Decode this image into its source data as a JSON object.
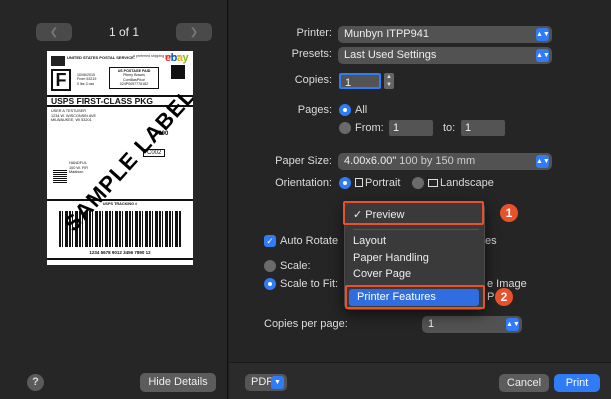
{
  "sidebar": {
    "page_indicator": "1 of 1",
    "prev_icon": "chevron-left-icon",
    "next_icon": "chevron-right-icon",
    "help_label": "?",
    "hide_details_label": "Hide Details",
    "preview": {
      "carrier_text": "UNITED STATES POSTAL SERVICE.",
      "ebay_small": "a preferred shipping service on",
      "ebay_logo": [
        "e",
        "b",
        "a",
        "y"
      ],
      "big_letter": "F",
      "date_text": [
        "10/06/2015",
        "From 53219",
        "0 lbs 3 ozs"
      ],
      "paid_text": [
        "US POSTAGE PAID",
        "Pitney Bowes",
        "ComBasPrice",
        "024P0097776182"
      ],
      "service": "USPS FIRST-CLASS PKG",
      "sender": [
        "USER A TESTUSER",
        "1234 W. WISCONSIN AVE",
        "MILWAUKEE, WI 53201"
      ],
      "number": "0000",
      "route": "C002",
      "ship_to": [
        "HANDFUL",
        "100 W. FIR",
        "Madison"
      ],
      "tracking_label": "USPS TRACKING #",
      "tracking_number": "1234 5678 9012 3456 7890 12",
      "watermark": "SAMPLE LABEL"
    }
  },
  "form": {
    "printer_label": "Printer:",
    "printer_value": "Munbyn ITPP941",
    "presets_label": "Presets:",
    "presets_value": "Last Used Settings",
    "copies_label": "Copies:",
    "copies_value": "1",
    "pages_label": "Pages:",
    "pages_all": "All",
    "pages_from": "From:",
    "pages_from_value": "1",
    "pages_to": "to:",
    "pages_to_value": "1",
    "paper_size_label": "Paper Size:",
    "paper_size_value": "4.00x6.00\"",
    "paper_size_detail": "100 by 150 mm",
    "orientation_label": "Orientation:",
    "portrait": "Portrait",
    "landscape": "Landscape",
    "auto_rotate": "Auto Rotate",
    "scale": "Scale:",
    "scale_to_fit": "Scale to Fit:",
    "partial_es": "es",
    "partial_image": "e Image",
    "partial_p": "P",
    "copies_per_page_label": "Copies per page:",
    "copies_per_page_value": "1"
  },
  "menu": {
    "items": [
      {
        "label": "Preview",
        "check": "✓"
      },
      {
        "label": "Layout"
      },
      {
        "label": "Paper Handling"
      },
      {
        "label": "Cover Page"
      },
      {
        "label": "Printer Features"
      }
    ]
  },
  "callouts": [
    "1",
    "2"
  ],
  "bottom": {
    "pdf_label": "PDF",
    "cancel_label": "Cancel",
    "print_label": "Print"
  },
  "colors": {
    "accent": "#2f7cf6",
    "callout": "#e8512a",
    "background": "#252525"
  }
}
